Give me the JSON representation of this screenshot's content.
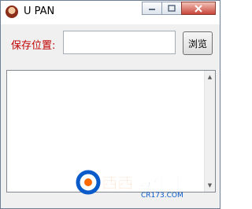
{
  "window": {
    "title": "U PAN",
    "app_icon": "app-logo-icon"
  },
  "title_controls": {
    "minimize_icon": "minimize-icon",
    "maximize_icon": "maximize-icon",
    "close_icon": "close-icon"
  },
  "toolbar": {
    "save_location_label": "保存位置:",
    "path_value": "",
    "browse_label": "浏览"
  },
  "list": {
    "items": [],
    "scroll_up_icon": "scroll-up-icon",
    "scroll_down_icon": "scroll-down-icon"
  },
  "watermark": {
    "brand": "西西",
    "brand_suffix": "软件园",
    "url": "CR173.COM",
    "accent": "#0a5bc9",
    "orange": "#ff6a00"
  }
}
